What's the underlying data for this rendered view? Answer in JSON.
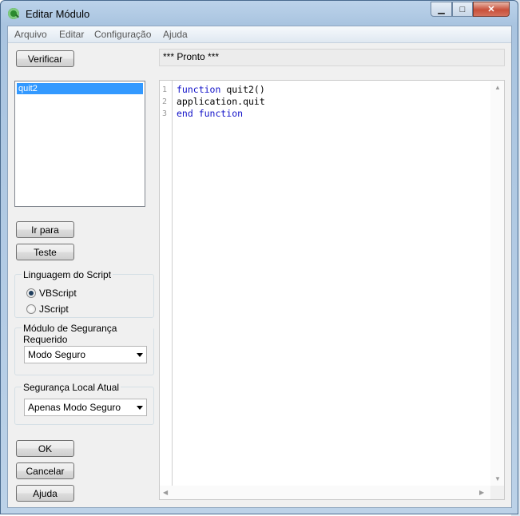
{
  "window": {
    "title": "Editar Módulo",
    "icon": "qlikview-app-icon"
  },
  "titlebar_buttons": {
    "minimize": "▁",
    "maximize": "□",
    "close": "✕"
  },
  "menu": [
    "Arquivo",
    "Editar",
    "Configuração",
    "Ajuda"
  ],
  "toolbar": {
    "verify_label": "Verificar",
    "status_text": "*** Pronto ***"
  },
  "modules": {
    "items": [
      "quit2"
    ],
    "selected": "quit2"
  },
  "buttons": {
    "goto": "Ir para",
    "test": "Teste",
    "ok": "OK",
    "cancel": "Cancelar",
    "help": "Ajuda"
  },
  "script_language": {
    "title": "Linguagem do Script",
    "options": [
      {
        "label": "VBScript",
        "selected": true
      },
      {
        "label": "JScript",
        "selected": false
      }
    ]
  },
  "security_module": {
    "title": "Módulo de Segurança Requerido",
    "value": "Modo Seguro"
  },
  "local_security": {
    "title": "Segurança Local Atual",
    "value": "Apenas Modo Seguro"
  },
  "editor": {
    "line_numbers": [
      "1",
      "2",
      "3"
    ],
    "lines": [
      {
        "kw": "function",
        "rest": " quit2()"
      },
      {
        "kw": "",
        "rest": "application.quit"
      },
      {
        "kw": "end function",
        "rest": ""
      }
    ]
  },
  "colors": {
    "keyword": "#1010c8",
    "selection": "#3399ff"
  }
}
